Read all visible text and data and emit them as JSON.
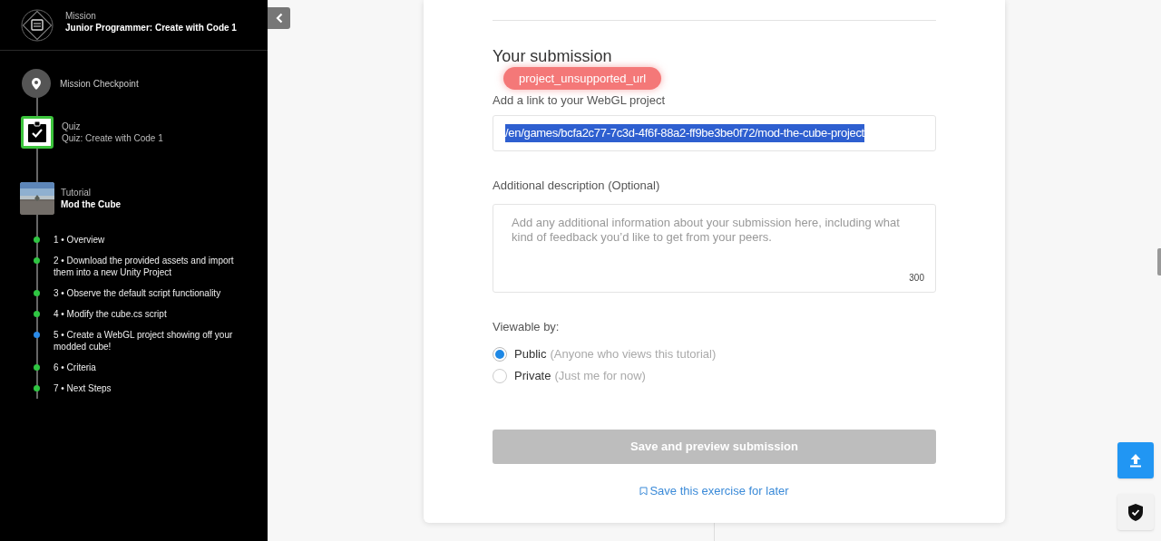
{
  "sidebar": {
    "mission": {
      "label": "Mission",
      "title": "Junior Programmer: Create with Code 1"
    },
    "checkpoint": {
      "title": "Mission Checkpoint"
    },
    "quiz": {
      "label": "Quiz",
      "title": "Quiz: Create with Code 1",
      "completed": true
    },
    "tutorial": {
      "label": "Tutorial",
      "title": "Mod the Cube",
      "kind": "picture"
    },
    "steps": [
      {
        "text": "1 • Overview",
        "current": false
      },
      {
        "text": "2 • Download the provided assets and import them into a new Unity Project",
        "current": false
      },
      {
        "text": "3 • Observe the default script functionality",
        "current": false
      },
      {
        "text": "4 • Modify the cube.cs script",
        "current": false
      },
      {
        "text": "5 • Create a WebGL project showing off your modded cube!",
        "current": true
      },
      {
        "text": "6 • Criteria",
        "current": false
      },
      {
        "text": "7 • Next Steps",
        "current": false
      }
    ]
  },
  "form": {
    "heading": "Your submission",
    "error_tooltip": "project_unsupported_url",
    "link_label": "Add a link to your WebGL project",
    "link_value": "/en/games/bcfa2c77-7c3d-4f6f-88a2-ff9be3be0f72/mod-the-cube-project",
    "description_label": "Additional description (Optional)",
    "description_placeholder": "Add any additional information about your submission here, including what kind of feedback you’d like to get from your peers.",
    "char_count": "300",
    "viewable_label": "Viewable by:",
    "options": [
      {
        "label": "Public",
        "hint": "(Anyone who views this tutorial)",
        "selected": true
      },
      {
        "label": "Private",
        "hint": "(Just me for now)",
        "selected": false
      }
    ],
    "submit": {
      "label": "Save and preview submission",
      "disabled": true
    },
    "save_later": "Save this exercise for later"
  }
}
